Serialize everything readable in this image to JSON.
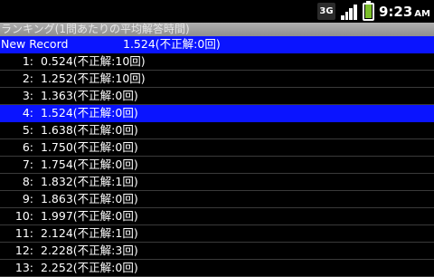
{
  "status_bar": {
    "network_badge": "3G",
    "time": "9:23",
    "ampm": "AM",
    "battery_color": "#7cbf2b"
  },
  "title": "ランキング(1問あたりの平均解答時間)",
  "new_record": {
    "label": "New Record",
    "value": "1.524(不正解:0回)"
  },
  "rankings": [
    {
      "rank": "1:",
      "time": "0.524(不正解:10回)"
    },
    {
      "rank": "2:",
      "time": "1.252(不正解:10回)"
    },
    {
      "rank": "3:",
      "time": "1.363(不正解:0回)"
    },
    {
      "rank": "4:",
      "time": "1.524(不正解:0回)"
    },
    {
      "rank": "5:",
      "time": "1.638(不正解:0回)"
    },
    {
      "rank": "6:",
      "time": "1.750(不正解:0回)"
    },
    {
      "rank": "7:",
      "time": "1.754(不正解:0回)"
    },
    {
      "rank": "8:",
      "time": "1.832(不正解:1回)"
    },
    {
      "rank": "9:",
      "time": "1.863(不正解:0回)"
    },
    {
      "rank": "10:",
      "time": "1.997(不正解:0回)"
    },
    {
      "rank": "11:",
      "time": "2.124(不正解:1回)"
    },
    {
      "rank": "12:",
      "time": "2.228(不正解:3回)"
    },
    {
      "rank": "13:",
      "time": "2.252(不正解:0回)"
    }
  ],
  "highlight_color": "#0a14ff"
}
